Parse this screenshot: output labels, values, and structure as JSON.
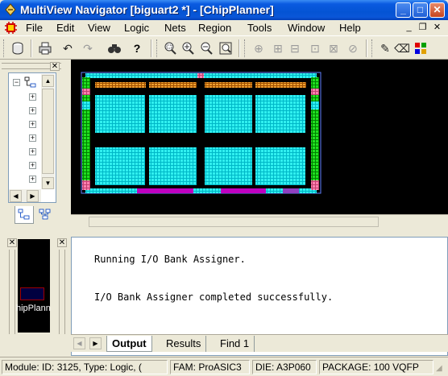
{
  "window": {
    "title": "MultiView Navigator [biguart2 *] - [ChipPlanner]",
    "controls": {
      "minimize": "_",
      "maximize": "□",
      "close": "✕"
    }
  },
  "menu": {
    "items": [
      "File",
      "Edit",
      "View",
      "Logic",
      "Nets",
      "Region",
      "Tools",
      "Window",
      "Help"
    ],
    "mdi_controls": {
      "minimize": "_",
      "restore": "❐",
      "close": "✕"
    }
  },
  "toolbar": {
    "icons": [
      "save-icon",
      "print-icon",
      "undo-icon",
      "redo-icon",
      "find-icon",
      "help-icon",
      "zoom-area-icon",
      "zoom-in-icon",
      "zoom-out-icon",
      "zoom-fit-icon",
      "macro-icon",
      "lock-icon",
      "unlock-icon",
      "commit-icon",
      "move-icon",
      "unassign-icon",
      "pencil-icon",
      "eraser-icon",
      "color-icon"
    ]
  },
  "tree": {
    "tab_icons": [
      "hierarchy-tab-icon",
      "ports-tab-icon"
    ]
  },
  "minimap": {
    "label": "hipPlann"
  },
  "output": {
    "lines": [
      "Running I/O Bank Assigner.",
      "I/O Bank Assigner completed successfully."
    ],
    "tabs": [
      "Output",
      "Results",
      "Find 1"
    ],
    "active_tab": "Output"
  },
  "status": {
    "module": "Module: ID: 3125, Type: Logic, (",
    "family": "FAM: ProASIC3",
    "die": "DIE: A3P060",
    "package": "PACKAGE: 100 VQFP"
  },
  "colors": {
    "titlebar": "#0454d4",
    "chip_core": "#00e0e0",
    "io_ring_green": "#00c800",
    "io_ring_magenta": "#d000d0",
    "io_ring_orange": "#e08000",
    "io_ring_pink": "#ff70a0"
  }
}
